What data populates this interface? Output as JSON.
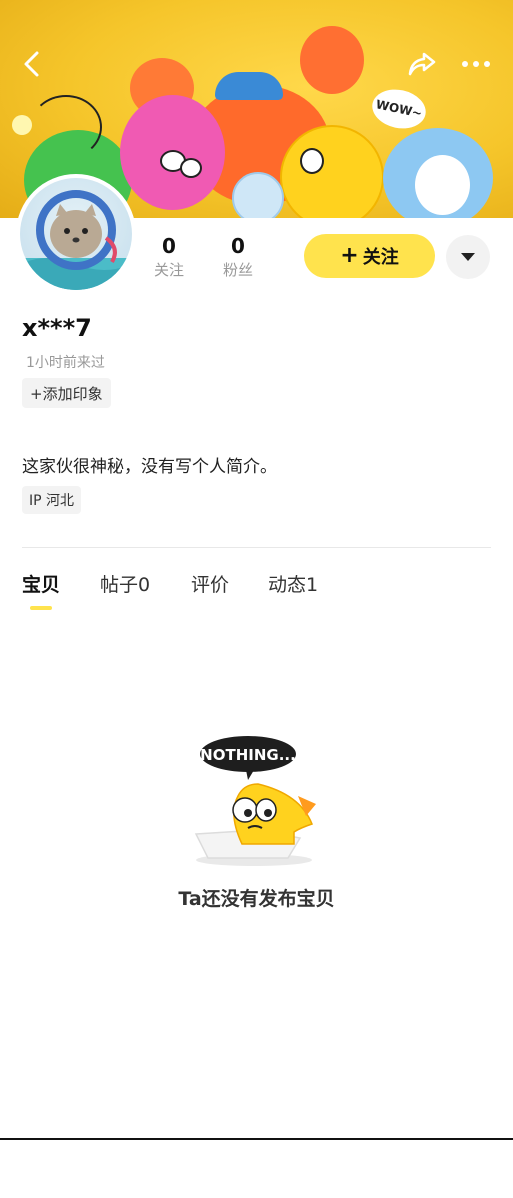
{
  "banner": {
    "sticker_text": "WOW~"
  },
  "nav": {
    "back_icon": "chevron-left-icon",
    "share_icon": "share-icon",
    "more_icon": "more-dots-icon"
  },
  "profile": {
    "stats": [
      {
        "value": "0",
        "label": "关注"
      },
      {
        "value": "0",
        "label": "粉丝"
      }
    ],
    "follow_button": "关注",
    "username": "x***7",
    "last_seen": "1小时前来过",
    "add_impression": "+添加印象",
    "bio": "这家伙很神秘，没有写个人简介。",
    "ip_location": "IP 河北"
  },
  "tabs": [
    {
      "label": "宝贝",
      "active": true
    },
    {
      "label": "帖子0",
      "active": false
    },
    {
      "label": "评价",
      "active": false
    },
    {
      "label": "动态1",
      "active": false
    }
  ],
  "empty_state": {
    "bubble_text": "NOTHING...",
    "message": "Ta还没有发布宝贝"
  },
  "colors": {
    "accent": "#ffe34d",
    "banner": "#f5c52a"
  }
}
